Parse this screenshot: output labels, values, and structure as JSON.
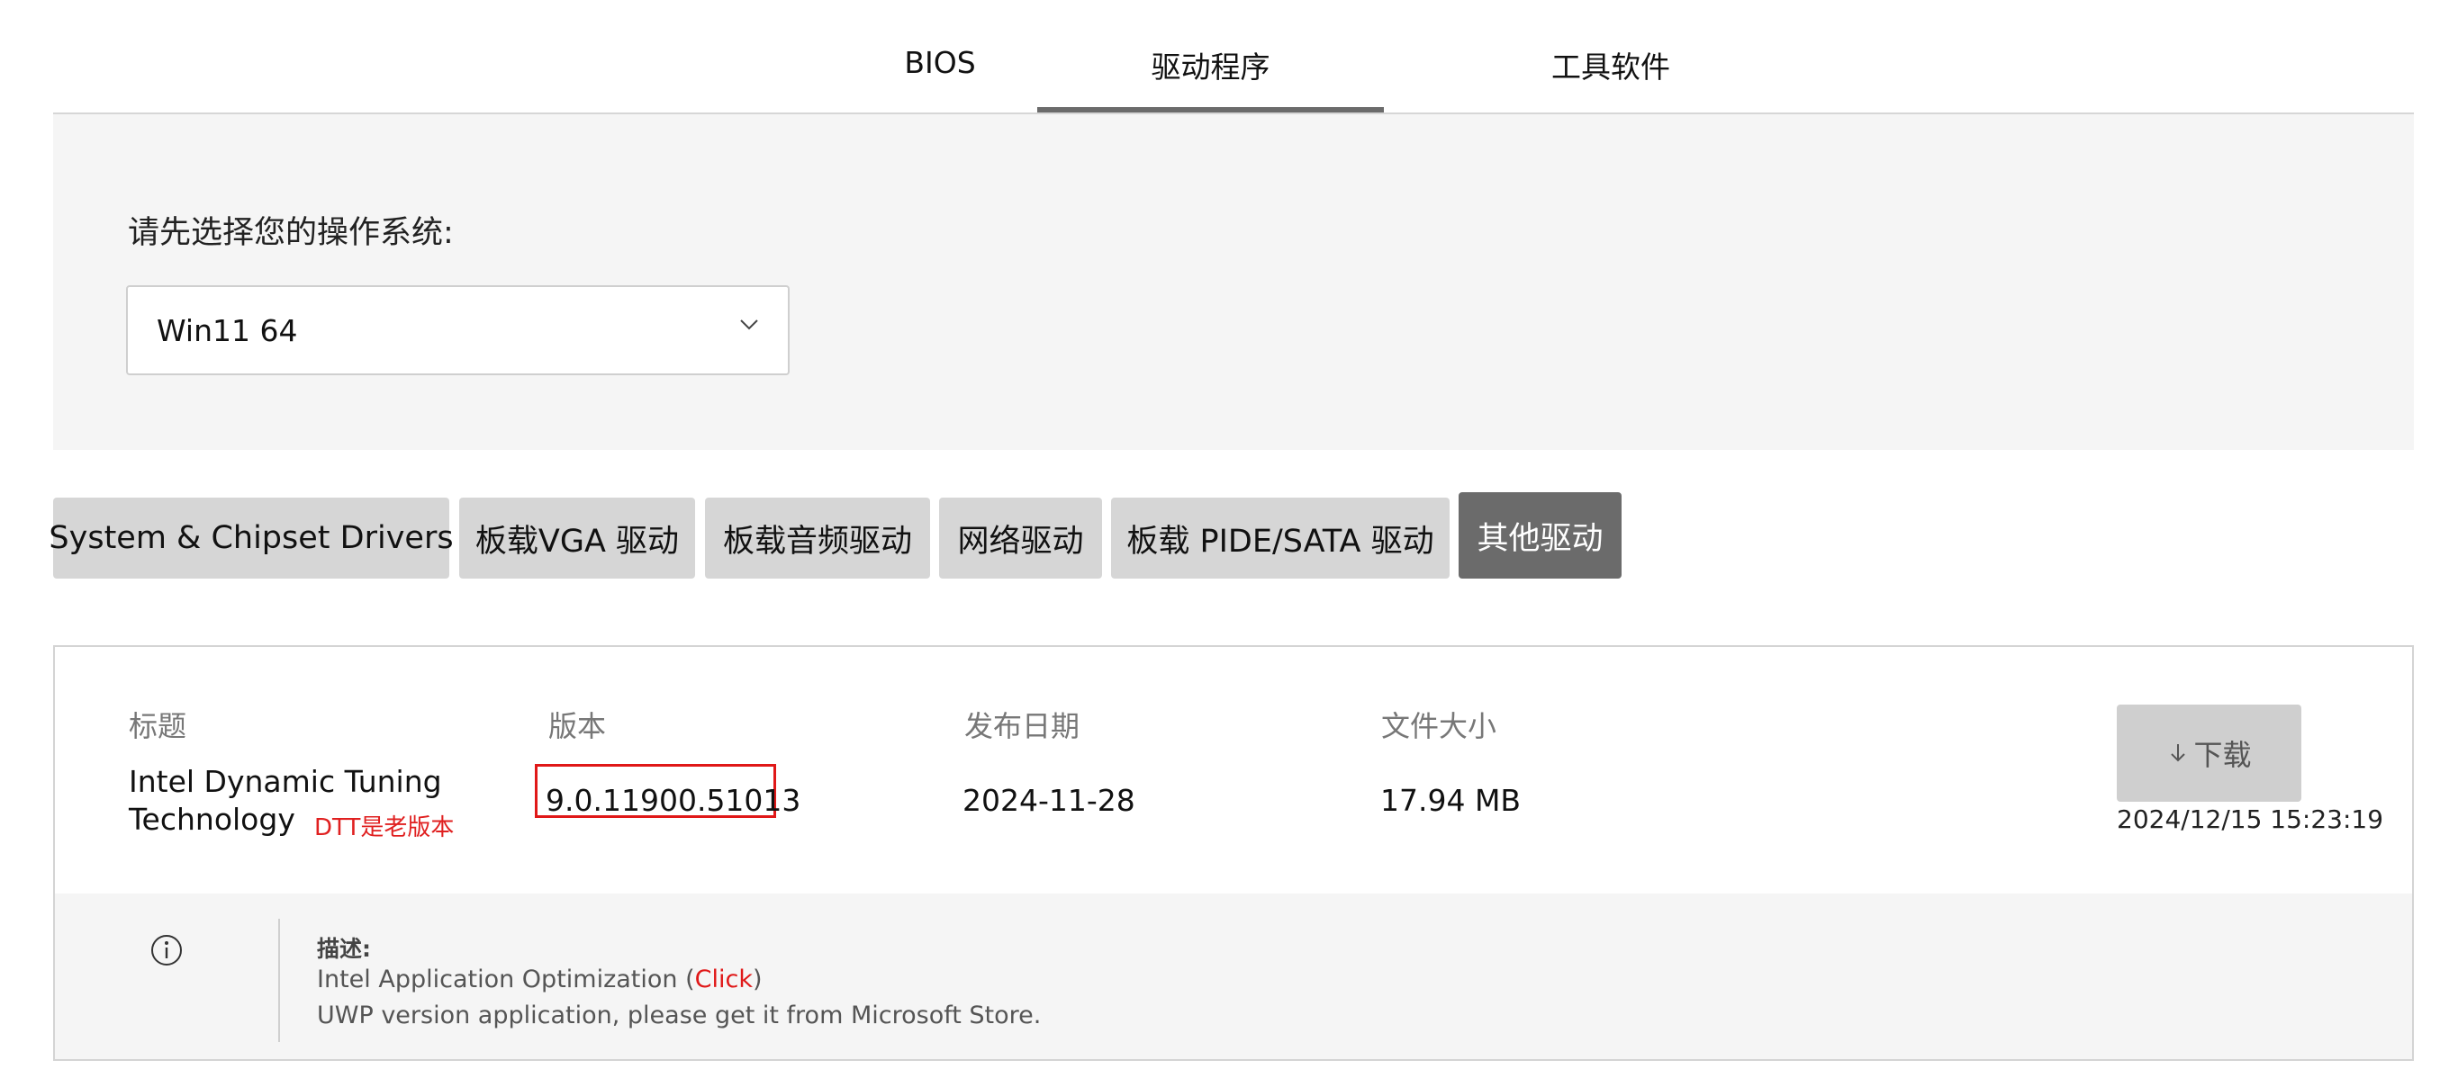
{
  "tabs": [
    {
      "label": "BIOS",
      "active": false
    },
    {
      "label": "驱动程序",
      "active": true
    },
    {
      "label": "工具软件",
      "active": false
    }
  ],
  "os_select": {
    "label": "请先选择您的操作系统:",
    "value": "Win11 64"
  },
  "categories": [
    {
      "label": "System & Chipset Drivers",
      "active": false
    },
    {
      "label": "板载VGA 驱动",
      "active": false
    },
    {
      "label": "板载音频驱动",
      "active": false
    },
    {
      "label": "网络驱动",
      "active": false
    },
    {
      "label": "板载 PIDE/SATA 驱动",
      "active": false
    },
    {
      "label": "其他驱动",
      "active": true
    }
  ],
  "driver_table": {
    "headers": {
      "title": "标题",
      "version": "版本",
      "date": "发布日期",
      "size": "文件大小"
    },
    "row": {
      "title_line1": "Intel Dynamic Tuning",
      "title_line2": "Technology",
      "annotation": "DTT是老版本",
      "version": "9.0.11900.51013",
      "date": "2024-11-28",
      "size": "17.94 MB",
      "download_label": "下载",
      "download_icon": "download-arrow-icon",
      "timestamp": "2024/12/15 15:23:19"
    },
    "description": {
      "label": "描述:",
      "line1_prefix": "Intel Application Optimization (",
      "line1_link": "Click",
      "line1_suffix": ")",
      "line2": "UWP version application, please get it from Microsoft Store.",
      "icon": "info-icon"
    }
  },
  "colors": {
    "active_tab_underline": "#6b6b6b",
    "active_category": "#6b6b6b",
    "category": "#d6d6d6",
    "highlight_red": "#e01818",
    "panel_bg": "#f5f5f5"
  }
}
